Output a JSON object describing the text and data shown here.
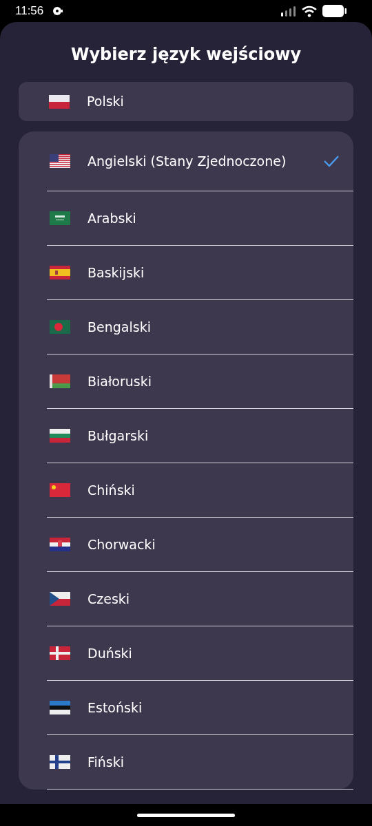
{
  "status_bar": {
    "time": "11:56"
  },
  "title": "Wybierz język wejściowy",
  "current": {
    "label": "Polski",
    "kind": "poland"
  },
  "languages": [
    {
      "label": "Angielski (Stany Zjednoczone)",
      "kind": "usa",
      "selected": true
    },
    {
      "label": "Arabski",
      "kind": "saudi",
      "selected": false
    },
    {
      "label": "Baskijski",
      "kind": "spain",
      "selected": false
    },
    {
      "label": "Bengalski",
      "kind": "bangladesh",
      "selected": false
    },
    {
      "label": "Białoruski",
      "kind": "belarus",
      "selected": false
    },
    {
      "label": "Bułgarski",
      "kind": "bulgaria",
      "selected": false
    },
    {
      "label": "Chiński",
      "kind": "china",
      "selected": false
    },
    {
      "label": "Chorwacki",
      "kind": "croatia",
      "selected": false
    },
    {
      "label": "Czeski",
      "kind": "czech",
      "selected": false
    },
    {
      "label": "Duński",
      "kind": "denmark",
      "selected": false
    },
    {
      "label": "Estoński",
      "kind": "estonia",
      "selected": false
    },
    {
      "label": "Fiński",
      "kind": "finland",
      "selected": false
    }
  ]
}
